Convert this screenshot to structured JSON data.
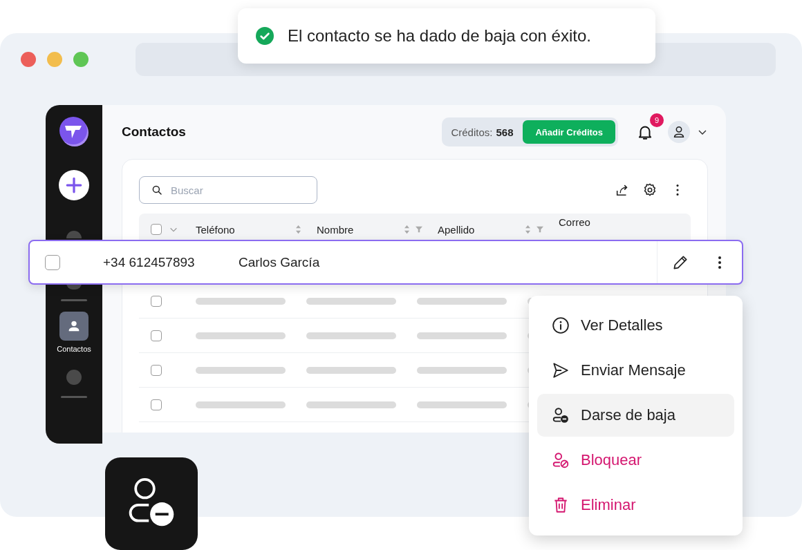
{
  "toast": {
    "text": "El contacto se ha dado de baja con éxito."
  },
  "sidebar": {
    "items": [
      {
        "label": "Contactos",
        "selected": true
      }
    ]
  },
  "page": {
    "title": "Contactos"
  },
  "credits": {
    "label": "Créditos:",
    "value": "568",
    "button": "Añadir Créditos"
  },
  "notifications": {
    "count": "9"
  },
  "table": {
    "search": {
      "placeholder": "Buscar"
    },
    "select_all": {
      "checked": false
    },
    "columns": [
      {
        "label": "Teléfono",
        "sortable": true,
        "filterable": false
      },
      {
        "label": "Nombre",
        "sortable": true,
        "filterable": true
      },
      {
        "label": "Apellido",
        "sortable": true,
        "filterable": true
      },
      {
        "label": "Correo",
        "sortable": false,
        "filterable": false
      }
    ],
    "highlighted_row": {
      "checked": false,
      "phone": "+34 612457893",
      "name": "Carlos García"
    },
    "placeholder_rows": [
      {
        "checked": false
      },
      {
        "checked": false
      },
      {
        "checked": false
      },
      {
        "checked": false
      }
    ]
  },
  "menu": {
    "items": [
      {
        "label": "Ver Detalles",
        "kind": "info",
        "danger": false,
        "selected": false
      },
      {
        "label": "Enviar Mensaje",
        "kind": "send",
        "danger": false,
        "selected": false
      },
      {
        "label": "Darse de baja",
        "kind": "unsubscribe",
        "danger": false,
        "selected": true
      },
      {
        "label": "Bloquear",
        "kind": "block",
        "danger": true,
        "selected": false
      },
      {
        "label": "Eliminar",
        "kind": "delete",
        "danger": true,
        "selected": false
      }
    ]
  }
}
